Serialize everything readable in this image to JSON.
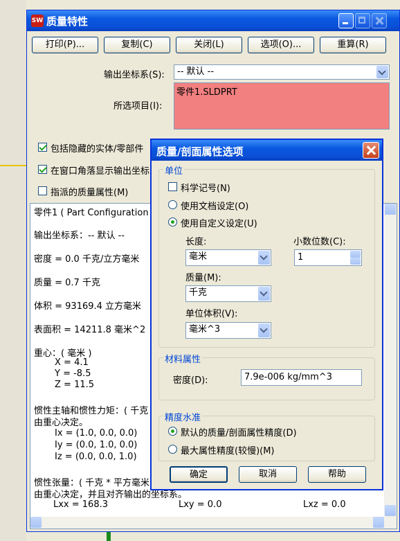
{
  "window": {
    "title": "质量特性",
    "app_icon": "SW",
    "buttons": {
      "print": "打印(P)...",
      "copy": "复制(C)",
      "close": "关闭(L)",
      "options": "选项(O)...",
      "recalc": "重算(R)"
    },
    "output_coord_label": "输出坐标系(S):",
    "output_coord_value": "-- 默认 --",
    "selected_items_label": "所选项目(I):",
    "selected_items": [
      "零件1.SLDPRT"
    ],
    "checkboxes": {
      "include_hidden": {
        "label": "包括隐藏的实体/零部件",
        "checked": true
      },
      "show_output_coord": {
        "label": "在窗口角落显示输出坐标",
        "checked": true
      },
      "assigned_mass": {
        "label": "指派的质量属性(M)",
        "checked": false
      }
    }
  },
  "results": {
    "lines": [
      "零件1 ( Part Configuration -",
      "输出坐标系：-- 默认 --",
      "密度 = 0.0 千克/立方毫米",
      "质量 = 0.7 千克",
      "体积 = 93169.4 立方毫米",
      "表面积 = 14211.8 毫米^2",
      "重心：( 毫米 )",
      "X = 4.1",
      "Y = -8.5",
      "Z = 11.5",
      "惯性主轴和惯性力矩：( 千克",
      "由重心决定。",
      "Ix = (1.0, 0.0, 0.0)",
      "Iy = (0.0, 1.0, 0.0)",
      "Iz = (0.0, 0.0, 1.0)",
      "惯性张量：( 千克 * 平方毫米",
      "由重心决定，并且对齐输出的坐标系。",
      "Lxx = 168.3",
      "Lxy = 0.0",
      "Lxz = 0.0"
    ]
  },
  "dialog": {
    "title": "质量/剖面属性选项",
    "units_group": "单位",
    "scientific": "科学记号(N)",
    "use_doc": "使用文档设定(O)",
    "use_custom": "使用自定义设定(U)",
    "length_label": "长度:",
    "length_value": "毫米",
    "decimals_label": "小数位数(C):",
    "decimals_value": "1",
    "mass_label": "质量(M):",
    "mass_value": "千克",
    "volume_label": "单位体积(V):",
    "volume_value": "毫米^3",
    "material_group": "材料属性",
    "density_label": "密度(D):",
    "density_value": "7.9e-006 kg/mm^3",
    "accuracy_group": "精度水准",
    "default_accuracy": "默认的质量/剖面属性精度(D)",
    "max_accuracy": "最大属性精度(较慢)(M)",
    "ok": "确定",
    "cancel": "取消",
    "help": "帮助"
  }
}
